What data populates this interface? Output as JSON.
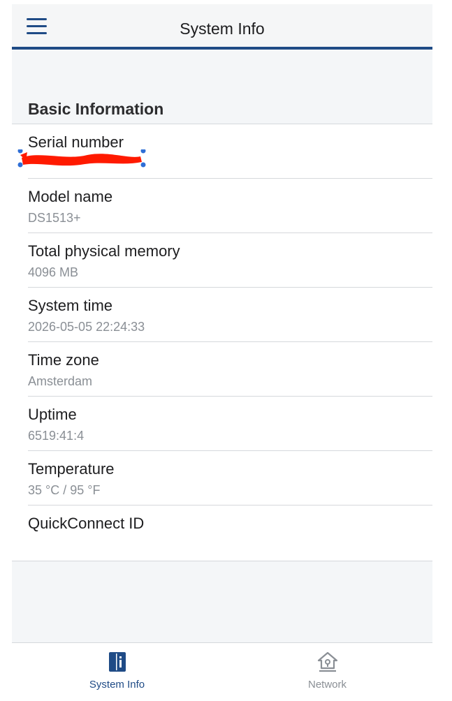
{
  "header": {
    "title": "System Info",
    "menu_icon": "hamburger-menu-icon"
  },
  "section": {
    "title": "Basic Information"
  },
  "rows": [
    {
      "label": "Serial number",
      "value": ""
    },
    {
      "label": "Model name",
      "value": "DS1513+"
    },
    {
      "label": "Total physical memory",
      "value": "4096 MB"
    },
    {
      "label": "System time",
      "value": "2026-05-05 22:24:33"
    },
    {
      "label": "Time zone",
      "value": "Amsterdam"
    },
    {
      "label": "Uptime",
      "value": "6519:41:4"
    },
    {
      "label": "Temperature",
      "value": "35 °C / 95 °F"
    },
    {
      "label": "QuickConnect ID",
      "value": ""
    }
  ],
  "tabs": [
    {
      "label": "System Info",
      "icon": "system-info-icon",
      "active": true
    },
    {
      "label": "Network",
      "icon": "network-house-icon",
      "active": false
    }
  ],
  "colors": {
    "accent": "#1f4b86",
    "redaction": "#ff1a00",
    "selection_handle": "#2f6fd6",
    "secondary_text": "#8a8f95"
  }
}
